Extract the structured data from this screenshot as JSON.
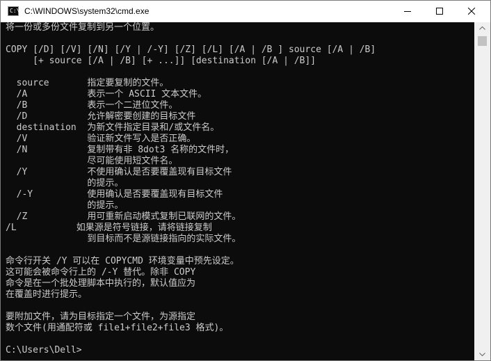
{
  "window": {
    "title": "C:\\WINDOWS\\system32\\cmd.exe",
    "app_icon_text": "C:\\",
    "controls": [
      "minimize-icon",
      "maximize-icon",
      "close-icon"
    ]
  },
  "console": {
    "lines": [
      "将一份或多份文件复制到另一个位置。",
      "",
      "COPY [/D] [/V] [/N] [/Y | /-Y] [/Z] [/L] [/A | /B ] source [/A | /B]",
      "     [+ source [/A | /B] [+ ...]] [destination [/A | /B]]",
      "",
      "  source       指定要复制的文件。",
      "  /A           表示一个 ASCII 文本文件。",
      "  /B           表示一个二进位文件。",
      "  /D           允许解密要创建的目标文件",
      "  destination  为新文件指定目录和/或文件名。",
      "  /V           验证新文件写入是否正确。",
      "  /N           复制带有非 8dot3 名称的文件时，",
      "               尽可能使用短文件名。",
      "  /Y           不使用确认是否要覆盖现有目标文件",
      "               的提示。",
      "  /-Y          使用确认是否要覆盖现有目标文件",
      "               的提示。",
      "  /Z           用可重新启动模式复制已联网的文件。",
      "/L           如果源是符号链接，请将链接复制",
      "               到目标而不是源链接指向的实际文件。",
      "",
      "命令行开关 /Y 可以在 COPYCMD 环境变量中预先设定。",
      "这可能会被命令行上的 /-Y 替代。除非 COPY",
      "命令是在一个批处理脚本中执行的，默认值应为",
      "在覆盖时进行提示。",
      "",
      "要附加文件，请为目标指定一个文件，为源指定",
      "数个文件(用通配符或 file1+file2+file3 格式)。",
      "",
      "C:\\Users\\Dell>"
    ]
  },
  "colors": {
    "console_bg": "#0c0c0c",
    "console_fg": "#cccccc",
    "titlebar_bg": "#ffffff",
    "scrollbar_bg": "#f0f0f0",
    "scroll_thumb": "#c2c2c2"
  }
}
